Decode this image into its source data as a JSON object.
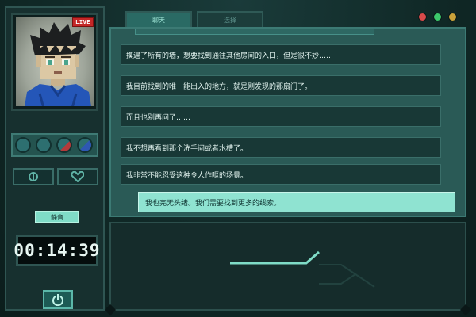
{
  "hud": {
    "live_badge": "LIVE",
    "mute_label": "静音",
    "timer": "00:14:39"
  },
  "tabs": [
    {
      "label": "聊天",
      "active": true
    },
    {
      "label": "选择",
      "active": false
    }
  ],
  "window_dots": [
    "#d84a4a",
    "#3cc86b",
    "#caa23a"
  ],
  "chat": {
    "messages": [
      {
        "speaker": "character",
        "text": "摸遍了所有的墙，想要找到通往其他房间的入口，但是很不妙……"
      },
      {
        "speaker": "character",
        "text": "我目前找到的唯一能出入的地方，就是刚发现的那扇门了。"
      },
      {
        "speaker": "character",
        "text": "而且也别再问了……"
      },
      {
        "speaker": "character",
        "text": "我不想再看到那个洗手间或者水槽了。"
      },
      {
        "speaker": "character",
        "text": "我非常不能忍受这种令人作呕的场景。"
      },
      {
        "speaker": "player",
        "text": "我也完无头绪。我们需要找到更多的线索。"
      }
    ]
  },
  "colors": {
    "accent": "#8fe3d1",
    "panel": "#2a5a56",
    "message_bg": "#183836",
    "live": "#c42727"
  },
  "icons": {
    "call": "signal-icon",
    "heart": "heart-icon",
    "power": "power-icon"
  }
}
